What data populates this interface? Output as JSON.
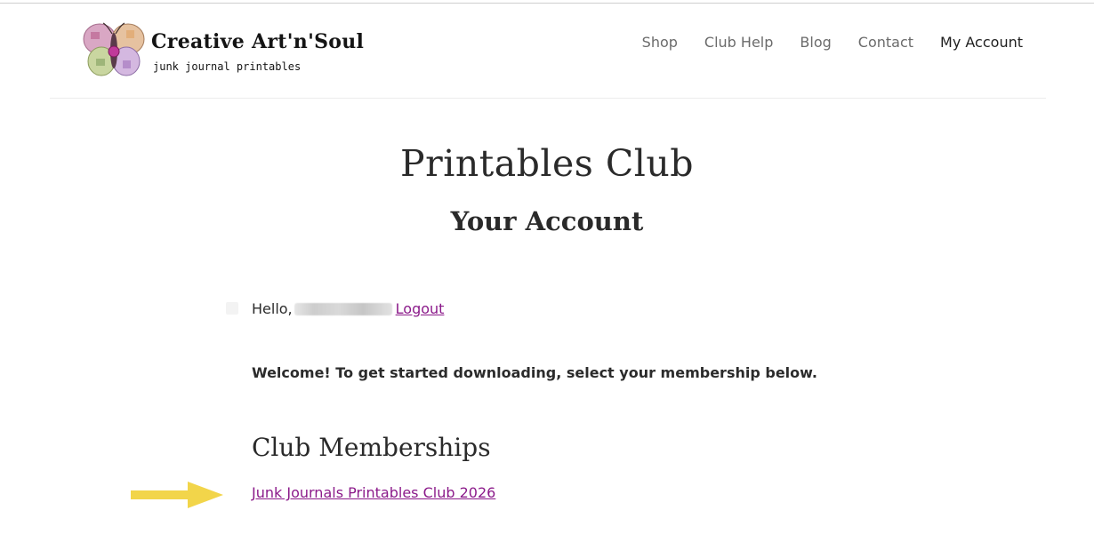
{
  "site": {
    "logo_title": "Creative Art'n'Soul",
    "logo_tagline": "junk journal printables",
    "logo_icon": "butterfly-icon"
  },
  "nav": {
    "items": [
      {
        "label": "Shop"
      },
      {
        "label": "Club Help"
      },
      {
        "label": "Blog"
      },
      {
        "label": "Contact"
      },
      {
        "label": "My Account",
        "current": true
      }
    ]
  },
  "page": {
    "title": "Printables Club",
    "subtitle": "Your Account"
  },
  "account": {
    "greeting": "Hello,",
    "logout_label": "Logout",
    "welcome_message": "Welcome! To get started downloading, select your membership below."
  },
  "memberships": {
    "heading": "Club Memberships",
    "items": [
      {
        "label": "Junk Journals Printables Club 2026"
      }
    ],
    "pointer_icon": "arrow-right-icon"
  },
  "colors": {
    "link": "#8b1a8a",
    "arrow": "#f2d54a",
    "text": "#2b2b2b"
  }
}
